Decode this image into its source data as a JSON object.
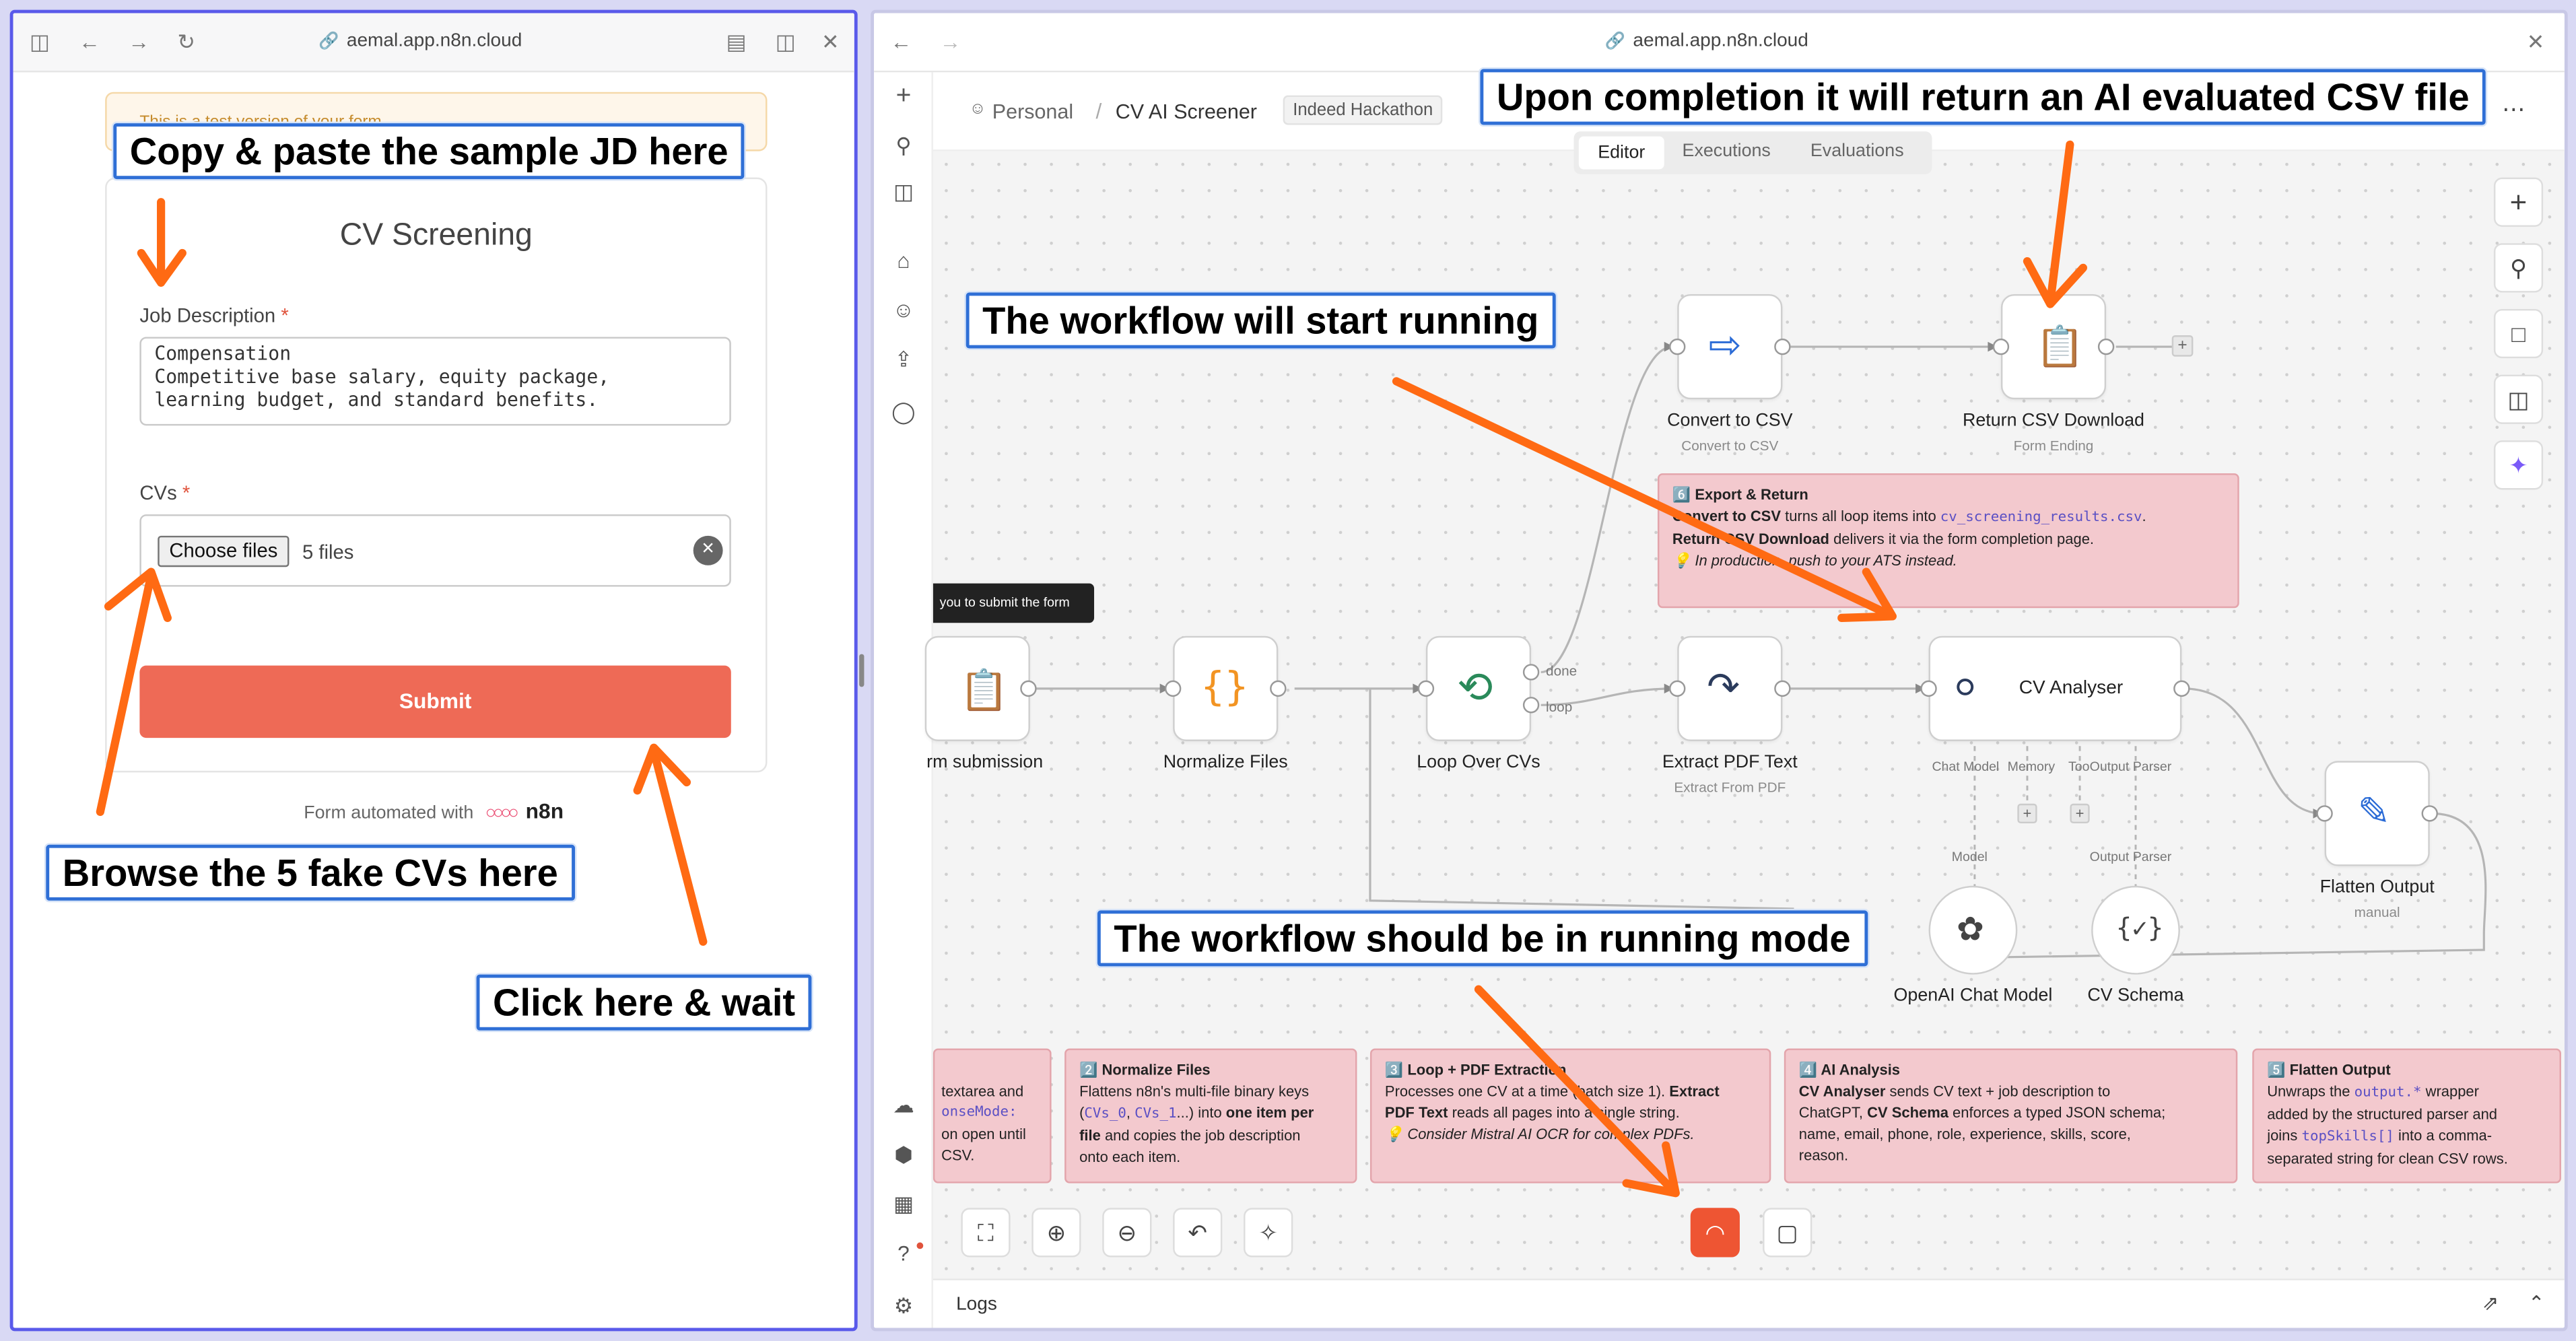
{
  "left_window": {
    "url": "aemal.app.n8n.cloud",
    "test_banner": "This is a test version of your form",
    "form_title": "CV Screening",
    "jd_label": "Job Description",
    "required_mark": "*",
    "jd_value": "Compensation\nCompetitive base salary, equity package,\nlearning budget, and standard benefits.",
    "cvs_label": "CVs",
    "choose_files": "Choose files",
    "files_count": "5 files",
    "submit": "Submit",
    "footer_prefix": "Form automated with",
    "footer_brand": "n8n"
  },
  "right_window": {
    "url": "aemal.app.n8n.cloud",
    "breadcrumb_personal": "Personal",
    "breadcrumb_sep": "/",
    "workflow_name": "CV AI Screener",
    "tag": "Indeed Hackathon",
    "more": "⋯",
    "tabs": [
      "Editor",
      "Executions",
      "Evaluations"
    ],
    "logs": "Logs",
    "tooltip": "you to submit the form"
  },
  "nodes": {
    "form_submission": {
      "label": "rm submission"
    },
    "normalize": {
      "label": "Normalize Files"
    },
    "loop": {
      "label": "Loop Over CVs",
      "done": "done",
      "loop": "loop"
    },
    "extract": {
      "label": "Extract PDF Text",
      "sub": "Extract From PDF"
    },
    "convert": {
      "label": "Convert to CSV",
      "sub": "Convert to CSV"
    },
    "return_csv": {
      "label": "Return CSV Download",
      "sub": "Form Ending"
    },
    "analyser": {
      "label": "CV Analyser",
      "chat_model": "Chat Model",
      "memory": "Memory",
      "tool": "Too",
      "output_parser": "Output Parser"
    },
    "flatten": {
      "label": "Flatten Output",
      "sub": "manual"
    },
    "openai": {
      "label": "OpenAI Chat Model",
      "port": "Model"
    },
    "schema": {
      "label": "CV Schema",
      "port": "Output Parser"
    }
  },
  "notes": {
    "export": {
      "title": "6️⃣ Export & Return",
      "l1a": "Convert to CSV",
      "l1b": " turns all loop items into ",
      "l1c": "cv_screening_results.csv",
      "l1d": ".",
      "l2a": "Return CSV Download",
      "l2b": " delivers it via the form completion page.",
      "l3": "💡 In production, push to your ATS instead."
    },
    "n1": {
      "l1": "textarea and",
      "l2": "onseMode:",
      "l3": "on open until",
      "l4": "CSV."
    },
    "n2": {
      "title": "2️⃣ Normalize Files",
      "l1": "Flattens n8n's multi-file binary keys",
      "l2a": "(",
      "l2b": "CVs_0",
      "l2c": ", ",
      "l2d": "CVs_1",
      "l2e": "...) into ",
      "l2f": "one item per",
      "l3a": "file",
      "l3b": " and copies the job description",
      "l4": "onto each item."
    },
    "n3": {
      "title": "3️⃣ Loop + PDF Extraction",
      "l1a": "Processes one CV at a time (batch size 1). ",
      "l1b": "Extract",
      "l2a": "PDF Text",
      "l2b": " reads all pages into a single string.",
      "l3": "💡 Consider Mistral AI OCR for complex PDFs."
    },
    "n4": {
      "title": "4️⃣ AI Analysis",
      "l1a": "CV Analyser",
      "l1b": " sends CV text + job description to",
      "l2a": "ChatGPT, ",
      "l2b": "CV Schema",
      "l2c": " enforces a typed JSON schema;",
      "l3": "name, email, phone, role, experience, skills, score,",
      "l4": "reason."
    },
    "n5": {
      "title": "5️⃣ Flatten Output",
      "l1a": "Unwraps the ",
      "l1b": "output.*",
      "l1c": " wrapper",
      "l2": "added by the structured parser and",
      "l3a": "joins ",
      "l3b": "topSkills[]",
      "l3c": " into a comma-",
      "l4": "separated string for clean CSV rows."
    }
  },
  "callouts": {
    "copy_paste": "Copy & paste the sample JD here",
    "browse": "Browse the 5 fake CVs here",
    "click": "Click here & wait",
    "completion": "Upon completion it will return an AI evaluated CSV file",
    "start_running": "The workflow will start running",
    "running_mode": "The workflow should be in running mode"
  },
  "colors": {
    "accent": "#ee6a56",
    "arrow": "#ff6a13",
    "callout_border": "#2f6fd6",
    "window_border": "#5a5aea",
    "note_bg": "#f3c9ce",
    "teal": "#3aa89b",
    "orange": "#f29423"
  },
  "icons": [
    "sidebar-icon",
    "back-icon",
    "forward-icon",
    "reload-icon",
    "lock-icon",
    "reader-icon",
    "split-icon",
    "close-icon",
    "plus-icon",
    "search-icon",
    "home-icon",
    "user-icon",
    "upload-icon",
    "chat-icon",
    "cloud-icon",
    "cube-icon",
    "chart-icon",
    "help-icon",
    "settings-icon",
    "fit-view-icon",
    "zoom-in-icon",
    "zoom-out-icon",
    "undo-icon",
    "tidy-icon",
    "loading-icon",
    "stop-icon",
    "sparkle-icon",
    "clipboard-icon",
    "code-braces-icon",
    "loop-icon",
    "export-icon",
    "robot-icon",
    "edit-icon",
    "openai-icon",
    "schema-icon"
  ]
}
